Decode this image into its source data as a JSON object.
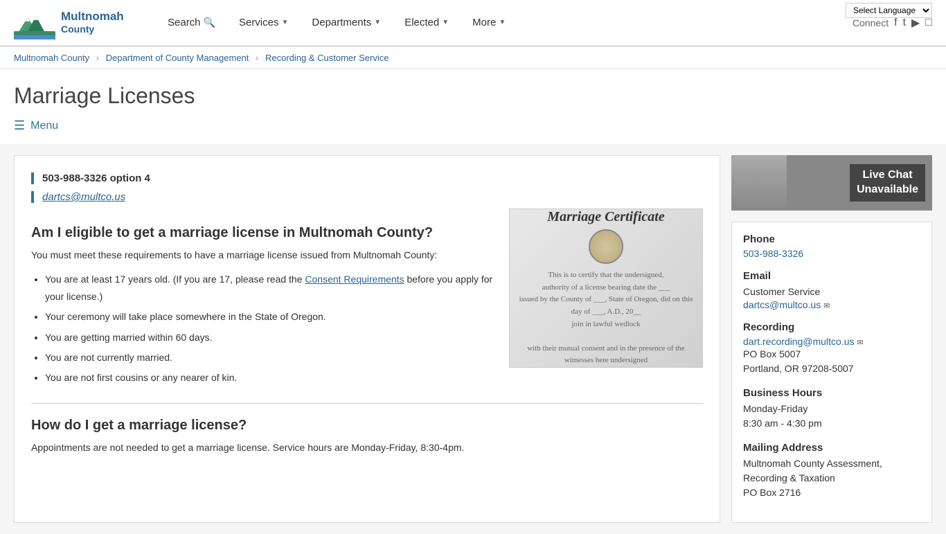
{
  "meta": {
    "title": "Marriage Licenses - Multnomah County"
  },
  "header": {
    "logo_line1": "Multnomah",
    "logo_line2": "County",
    "nav": [
      {
        "label": "Search",
        "has_icon": true,
        "has_chevron": false
      },
      {
        "label": "Services",
        "has_chevron": true
      },
      {
        "label": "Departments",
        "has_chevron": true
      },
      {
        "label": "Elected",
        "has_chevron": true
      },
      {
        "label": "More",
        "has_chevron": true
      }
    ],
    "connect_label": "Connect",
    "language_selector_label": "Select Language"
  },
  "breadcrumb": {
    "items": [
      {
        "label": "Multnomah County",
        "href": "#"
      },
      {
        "label": "Department of County Management",
        "href": "#"
      },
      {
        "label": "Recording & Customer Service",
        "href": "#"
      }
    ]
  },
  "page": {
    "title": "Marriage Licenses",
    "menu_label": "Menu"
  },
  "main": {
    "phone": "503-988-3326 option 4",
    "email": "dartcs@multco.us",
    "eligibility_heading": "Am I eligible to get a marriage license in Multnomah County?",
    "eligibility_intro": "You must meet these requirements to have a marriage license issued from Multnomah County:",
    "eligibility_items": [
      {
        "text": "You are at least 17 years old. (If you are 17, please read the ",
        "link_text": "Consent Requirements",
        "text_after": " before you apply for your license.)"
      },
      {
        "text": "Your ceremony will take place somewhere in the State of Oregon.",
        "link_text": "",
        "text_after": ""
      },
      {
        "text": "You are getting married within 60 days.",
        "link_text": "",
        "text_after": ""
      },
      {
        "text": "You are not currently married.",
        "link_text": "",
        "text_after": ""
      },
      {
        "text": "You are not first cousins or any nearer of kin.",
        "link_text": "",
        "text_after": ""
      }
    ],
    "how_to_heading": "How do I get a marriage license?",
    "how_to_text": "Appointments are not needed to get a marriage license. Service hours are Monday-Friday, 8:30-4pm.",
    "cert_image_title": "Marriage Certificate",
    "cert_image_subtitle": "This is to certify that the undersigned..."
  },
  "sidebar": {
    "live_chat_line1": "Live Chat",
    "live_chat_line2": "Unavailable",
    "phone_label": "Phone",
    "phone_number": "503-988-3326",
    "email_label": "Email",
    "email_customer_service_label": "Customer Service",
    "email_customer_service": "dartcs@multco.us",
    "recording_label": "Recording",
    "recording_email": "dart.recording@multco.us",
    "recording_address_line1": "PO Box 5007",
    "recording_address_line2": "Portland, OR 97208-5007",
    "business_hours_label": "Business Hours",
    "business_hours_days": "Monday-Friday",
    "business_hours_time": "8:30 am - 4:30 pm",
    "mailing_address_label": "Mailing Address",
    "mailing_address_line1": "Multnomah County Assessment,",
    "mailing_address_line2": "Recording & Taxation",
    "mailing_address_line3": "PO Box 2716"
  },
  "colors": {
    "brand_blue": "#2a6496",
    "teal": "#2a7899",
    "light_border": "#ddd"
  }
}
